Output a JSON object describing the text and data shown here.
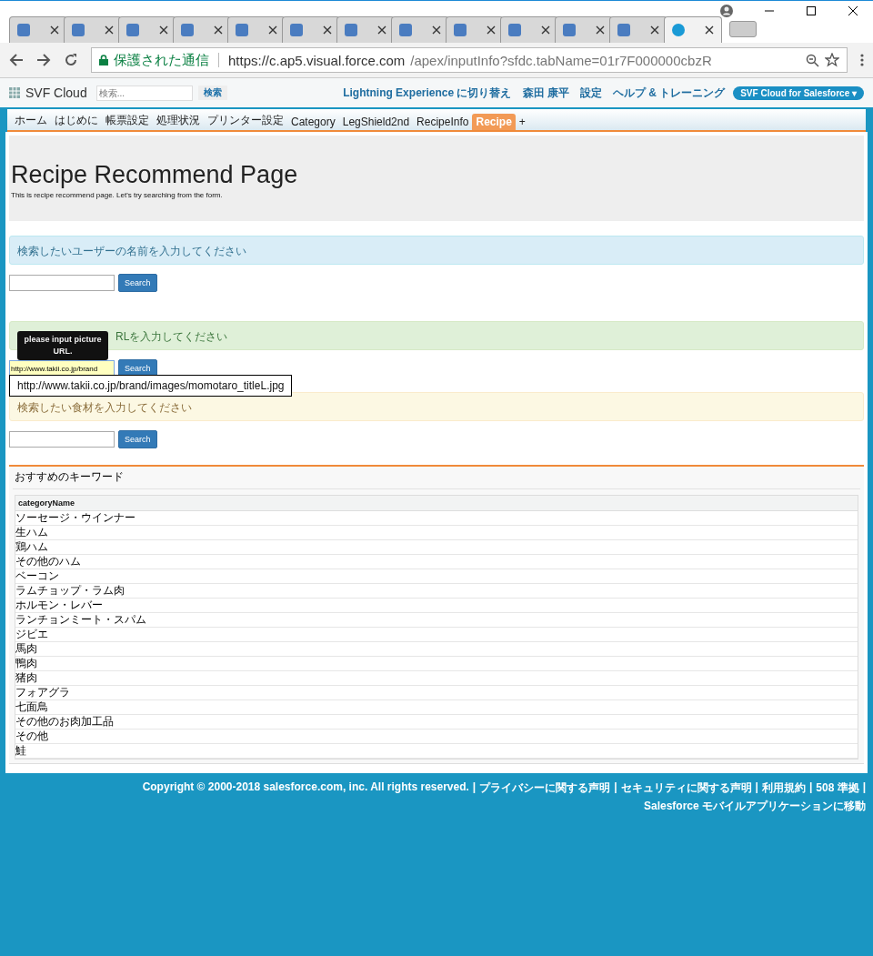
{
  "browser": {
    "tabs": [
      {
        "selected": false
      },
      {
        "selected": false
      },
      {
        "selected": false
      },
      {
        "selected": false
      },
      {
        "selected": false
      },
      {
        "selected": false
      },
      {
        "selected": false
      },
      {
        "selected": false
      },
      {
        "selected": false
      },
      {
        "selected": false
      },
      {
        "selected": false
      },
      {
        "selected": false
      },
      {
        "selected": true
      }
    ],
    "secure_label": "保護された通信",
    "url_host": "https://c.ap5.visual.force.com",
    "url_path": "/apex/inputInfo?sfdc.tabName=01r7F000000cbzR"
  },
  "header": {
    "logo": "SVF Cloud",
    "search_placeholder": "検索...",
    "search_button": "検索",
    "links": [
      "Lightning Experience に切り替え",
      "森田 康平",
      "設定",
      "ヘルプ & トレーニング"
    ],
    "app_menu": "SVF Cloud for Salesforce",
    "app_menu_caret": "▾"
  },
  "nav_tabs": [
    {
      "label": "ホーム",
      "selected": false
    },
    {
      "label": "はじめに",
      "selected": false
    },
    {
      "label": "帳票設定",
      "selected": false
    },
    {
      "label": "処理状況",
      "selected": false
    },
    {
      "label": "プリンター設定",
      "selected": false
    },
    {
      "label": "Category",
      "selected": false
    },
    {
      "label": "LegShield2nd",
      "selected": false
    },
    {
      "label": "RecipeInfo",
      "selected": false
    },
    {
      "label": "Recipe",
      "selected": true
    },
    {
      "label": "+",
      "selected": false
    }
  ],
  "jumbotron": {
    "title": "Recipe Recommend Page",
    "subtitle": "This is recipe recommend page. Let's try searching from the form."
  },
  "sections": [
    {
      "kind": "info",
      "alert": "検索したいユーザーの名前を入力してください",
      "button": "Search"
    },
    {
      "kind": "success",
      "alert": "RLを入力してください",
      "value": "http://www.takii.co.jp/brand",
      "button": "Search",
      "tooltip": "please input picture URL.",
      "suggestion": "http://www.takii.co.jp/brand/images/momotaro_titleL.jpg"
    },
    {
      "kind": "warning",
      "alert": "検索したい食材を入力してください",
      "button": "Search"
    }
  ],
  "keywords": {
    "title": "おすすめのキーワード",
    "column": "categoryName",
    "rows": [
      "ソーセージ・ウインナー",
      "生ハム",
      "鶏ハム",
      "その他のハム",
      "ベーコン",
      "ラムチョップ・ラム肉",
      "ホルモン・レバー",
      "ランチョンミート・スパム",
      "ジビエ",
      "馬肉",
      "鴨肉",
      "猪肉",
      "フォアグラ",
      "七面鳥",
      "その他のお肉加工品",
      "その他",
      "鮭"
    ]
  },
  "footer": {
    "copyright": "Copyright © 2000-2018 salesforce.com, inc. All rights reserved.",
    "separator": "|",
    "links": [
      "プライバシーに関する声明",
      "セキュリティに関する声明",
      "利用規約",
      "508 準拠",
      "Salesforce モバイルアプリケーションに移動"
    ]
  }
}
